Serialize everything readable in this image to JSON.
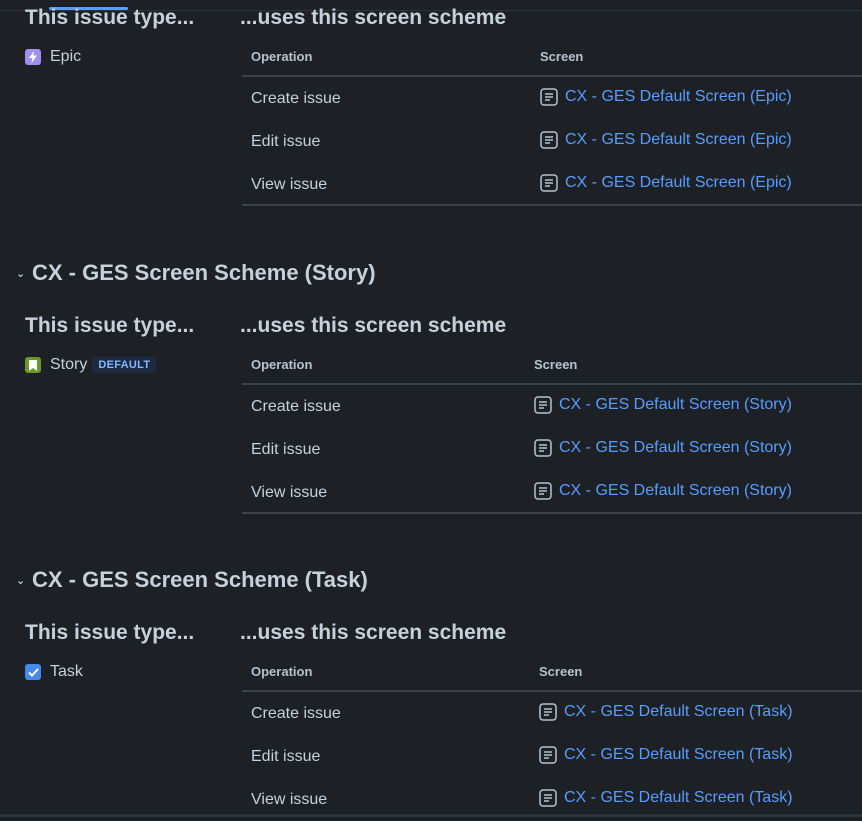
{
  "common": {
    "col_issue_type": "This issue type...",
    "col_scheme": "...uses this screen scheme",
    "th_operation": "Operation",
    "th_screen": "Screen"
  },
  "sections": [
    {
      "title": "",
      "issue_type": {
        "name": "Epic",
        "icon": "epic-icon",
        "color": "#9f8fef",
        "badge": ""
      },
      "rows": [
        {
          "operation": "Create issue",
          "screen": "CX - GES Default Screen (Epic)"
        },
        {
          "operation": "Edit issue",
          "screen": "CX - GES Default Screen (Epic)"
        },
        {
          "operation": "View issue",
          "screen": "CX - GES Default Screen (Epic)"
        }
      ]
    },
    {
      "title": "CX - GES Screen Scheme (Story)",
      "issue_type": {
        "name": "Story",
        "icon": "story-icon",
        "color": "#6a9a23",
        "badge": "DEFAULT"
      },
      "rows": [
        {
          "operation": "Create issue",
          "screen": "CX - GES Default Screen (Story)"
        },
        {
          "operation": "Edit issue",
          "screen": "CX - GES Default Screen (Story)"
        },
        {
          "operation": "View issue",
          "screen": "CX - GES Default Screen (Story)"
        }
      ]
    },
    {
      "title": "CX - GES Screen Scheme (Task)",
      "issue_type": {
        "name": "Task",
        "icon": "task-icon",
        "color": "#4688ec",
        "badge": ""
      },
      "rows": [
        {
          "operation": "Create issue",
          "screen": "CX - GES Default Screen (Task)"
        },
        {
          "operation": "Edit issue",
          "screen": "CX - GES Default Screen (Task)"
        },
        {
          "operation": "View issue",
          "screen": "CX - GES Default Screen (Task)"
        }
      ]
    }
  ],
  "colors": {
    "link": "#579dff",
    "background": "#1d2125",
    "text": "#c7d1db"
  }
}
